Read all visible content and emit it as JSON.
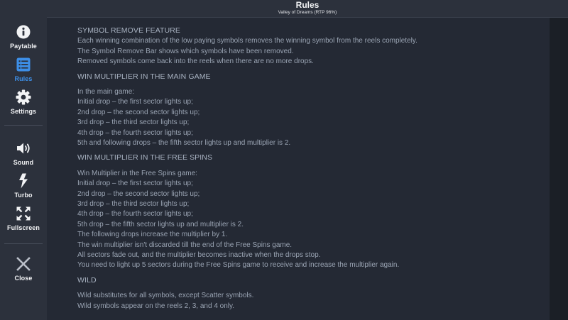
{
  "header": {
    "title": "Rules",
    "subtitle": "Valley of Dreams (RTP 96%)"
  },
  "sidebar": {
    "items": [
      {
        "label": "Paytable",
        "icon": "info-icon"
      },
      {
        "label": "Rules",
        "icon": "list-icon",
        "active": true
      },
      {
        "label": "Settings",
        "icon": "gear-icon"
      },
      {
        "label": "Sound",
        "icon": "speaker-icon"
      },
      {
        "label": "Turbo",
        "icon": "lightning-icon"
      },
      {
        "label": "Fullscreen",
        "icon": "fullscreen-icon"
      },
      {
        "label": "Close",
        "icon": "close-icon"
      }
    ]
  },
  "colors": {
    "accent": "#3d8fe8",
    "sidebar_bg": "#2c313c",
    "content_bg": "#242934",
    "text": "#9aa4b3"
  },
  "rules": {
    "symbol_remove": {
      "heading": "SYMBOL REMOVE FEATURE",
      "lines": [
        "Each winning combination of the low paying symbols removes the winning symbol from the reels completely.",
        "The Symbol Remove Bar shows which symbols have been removed.",
        "Removed symbols come back into the reels when there are no more drops."
      ]
    },
    "main_multiplier": {
      "heading": "WIN MULTIPLIER IN THE MAIN GAME",
      "lines": [
        "In the main game:",
        "Initial drop – the first sector lights up;",
        "2nd drop – the second sector lights up;",
        "3rd drop – the third sector lights up;",
        "4th drop – the fourth sector lights up;",
        "5th and following drops – the fifth sector lights up and multiplier is 2."
      ]
    },
    "free_spins_multiplier": {
      "heading": "WIN MULTIPLIER IN THE FREE SPINS",
      "lines": [
        "Win Multiplier in the Free Spins game:",
        "Initial drop – the first sector lights up;",
        "2nd drop – the second sector lights up;",
        "3rd drop – the third sector lights up;",
        "4th drop – the fourth sector lights up;",
        "5th drop – the fifth sector lights up and multiplier is 2.",
        "The following drops increase the multiplier by 1.",
        "The win multiplier isn't discarded till the end of the Free Spins game.",
        "All sectors fade out, and the multiplier becomes inactive when the drops stop.",
        "You need to light up 5 sectors during the Free Spins game to receive and increase the multiplier again."
      ]
    },
    "wild": {
      "heading": "WILD",
      "lines": [
        "Wild substitutes for all symbols, except Scatter symbols.",
        "Wild symbols appear on the reels 2, 3, and 4 only."
      ]
    }
  }
}
